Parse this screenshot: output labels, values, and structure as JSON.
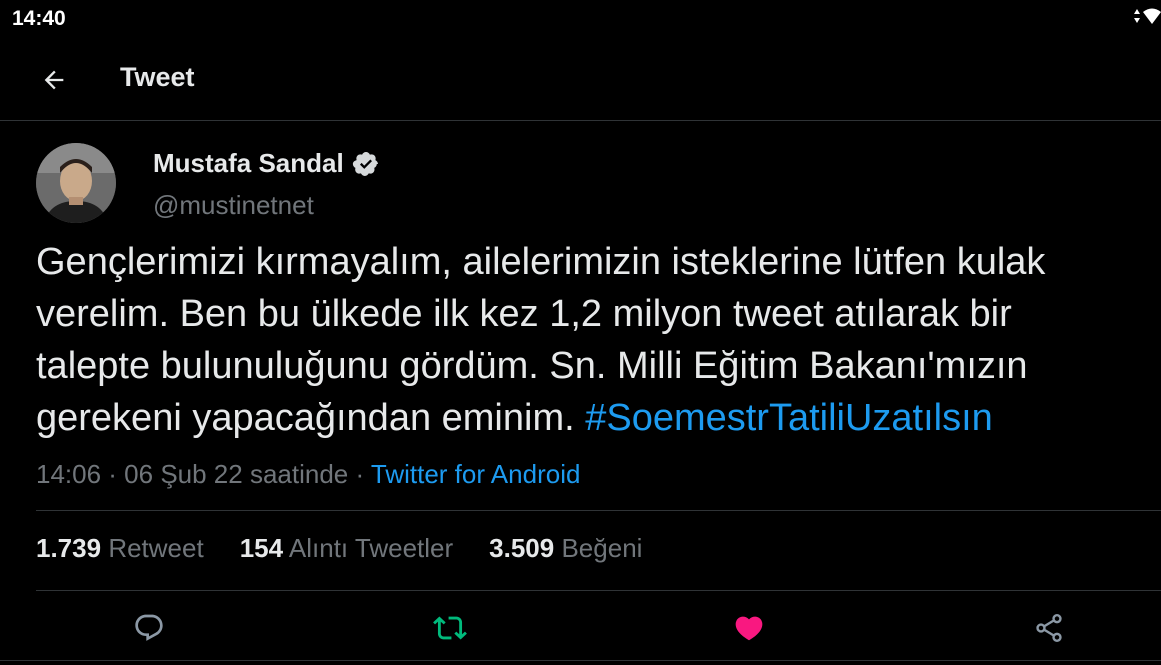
{
  "status_bar": {
    "time": "14:40"
  },
  "header": {
    "title": "Tweet"
  },
  "author": {
    "name": "Mustafa Sandal",
    "handle": "@mustinetnet",
    "verified": true
  },
  "tweet": {
    "lines": [
      "Gençlerimizi kırmayalım, ailelerimizin isteklerine lütfen kulak",
      "verelim. Ben bu ülkede ilk kez 1,2 milyon tweet atılarak bir",
      "talepte bulunuluğunu gördüm. Sn. Milli Eğitim Bakanı'mızın",
      "gerekeni yapacağından eminim. "
    ],
    "hashtag": "#SoemestrTatiliUzatılsın"
  },
  "meta": {
    "timestamp": "14:06 · 06 Şub 22 saatinde · ",
    "source": "Twitter for Android"
  },
  "stats": {
    "retweets": {
      "count": "1.739",
      "label": "Retweet"
    },
    "quotes": {
      "count": "154",
      "label": "Alıntı Tweetler"
    },
    "likes": {
      "count": "3.509",
      "label": "Beğeni"
    }
  },
  "colors": {
    "accent": "#1d9bf0",
    "retweet": "#00ba7c",
    "like": "#f91880",
    "muted": "#71767b",
    "text": "#e7e9ea"
  },
  "icons": [
    "back-arrow-icon",
    "verified-badge-icon",
    "reply-icon",
    "retweet-icon",
    "like-icon",
    "share-icon"
  ]
}
